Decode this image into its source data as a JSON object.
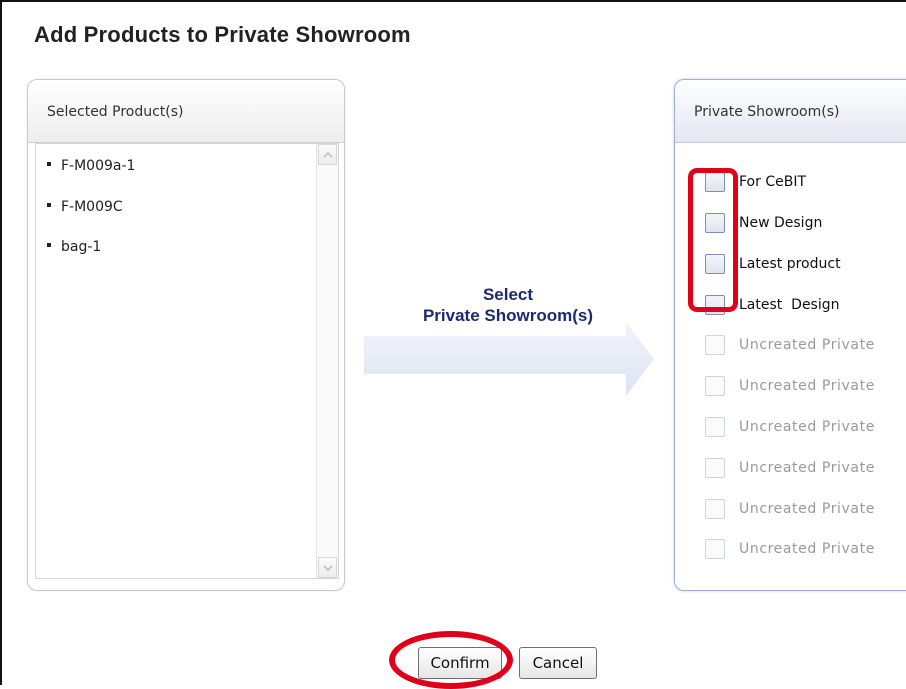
{
  "dialog": {
    "title": "Add Products to Private Showroom"
  },
  "selected_products": {
    "header": "Selected Product(s)",
    "items": [
      "F-M009a-1",
      "F-M009C",
      "bag-1"
    ]
  },
  "instruction": {
    "line1": "Select",
    "line2": "Private Showroom(s)"
  },
  "private_showrooms": {
    "header": "Private Showroom(s)",
    "items": [
      {
        "label": "For CeBIT",
        "enabled": true,
        "checked": false
      },
      {
        "label": "New Design",
        "enabled": true,
        "checked": false
      },
      {
        "label": "Latest product",
        "enabled": true,
        "checked": false
      },
      {
        "label": "Latest  Design",
        "enabled": true,
        "checked": false
      },
      {
        "label": "Uncreated Private",
        "enabled": false,
        "checked": false
      },
      {
        "label": "Uncreated Private",
        "enabled": false,
        "checked": false
      },
      {
        "label": "Uncreated Private",
        "enabled": false,
        "checked": false
      },
      {
        "label": "Uncreated Private",
        "enabled": false,
        "checked": false
      },
      {
        "label": "Uncreated Private",
        "enabled": false,
        "checked": false
      },
      {
        "label": "Uncreated Private",
        "enabled": false,
        "checked": false
      }
    ]
  },
  "buttons": {
    "confirm_label": "Confirm",
    "cancel_label": "Cancel"
  },
  "colors": {
    "highlight": "#e1001a",
    "instruction_text": "#1d2a73",
    "arrow_fill": "#e6ebf7"
  },
  "icons": {
    "scroll_up": "chevron-up-icon",
    "scroll_down": "chevron-down-icon",
    "direction_arrow": "right-arrow-icon"
  }
}
